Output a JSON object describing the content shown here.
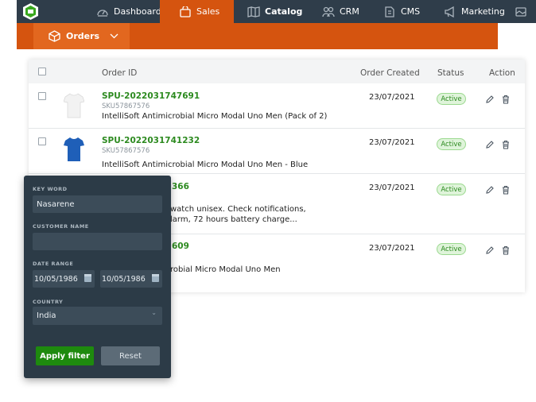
{
  "nav": {
    "items": [
      {
        "label": "Dashboard",
        "icon": "gauge-icon"
      },
      {
        "label": "Sales",
        "icon": "shopping-bag-icon",
        "active": true
      },
      {
        "label": "Catalog",
        "icon": "book-icon"
      },
      {
        "label": "CRM",
        "icon": "people-icon"
      },
      {
        "label": "CMS",
        "icon": "document-icon"
      },
      {
        "label": "Marketing",
        "icon": "megaphone-icon"
      }
    ],
    "extra_icon": "image-icon"
  },
  "subnav": {
    "label": "Orders",
    "icon": "box-icon"
  },
  "table": {
    "columns": {
      "order_id": "Order ID",
      "created": "Order Created",
      "status": "Status",
      "action": "Action"
    },
    "rows": [
      {
        "code": "SPU-2022031747691",
        "sku": "SKU57867576",
        "name": "IntelliSoft Antimicrobial Micro Modal Uno Men (Pack of 2)",
        "date": "23/07/2021",
        "status": "Active"
      },
      {
        "code": "SPU-2022031741232",
        "sku": "SKU57867576",
        "name": "IntelliSoft Antimicrobial Micro Modal Uno Men - Blue",
        "date": "23/07/2021",
        "status": "Active"
      },
      {
        "code_visible": "366",
        "name_line1": "watch unisex. Check notifications,",
        "name_line2": "larm, 72 hours battery charge...",
        "date": "23/07/2021",
        "status": "Active"
      },
      {
        "code_visible": "609",
        "name": "robial Micro Modal Uno Men",
        "date": "23/07/2021",
        "status": "Active"
      }
    ]
  },
  "filter": {
    "keyword_label": "KEY WORD",
    "keyword_value": "Nasarene",
    "customer_label": "CUSTOMER NAME",
    "customer_value": "",
    "date_label": "DATE RANGE",
    "date_from": "10/05/1986",
    "date_to": "10/05/1986",
    "country_label": "COUNTRY",
    "country_value": "India",
    "apply_label": "Apply filter",
    "reset_label": "Reset"
  },
  "colors": {
    "nav_bg": "#2f3d4a",
    "accent": "#d5540f",
    "status_green": "#2c8a1f"
  }
}
